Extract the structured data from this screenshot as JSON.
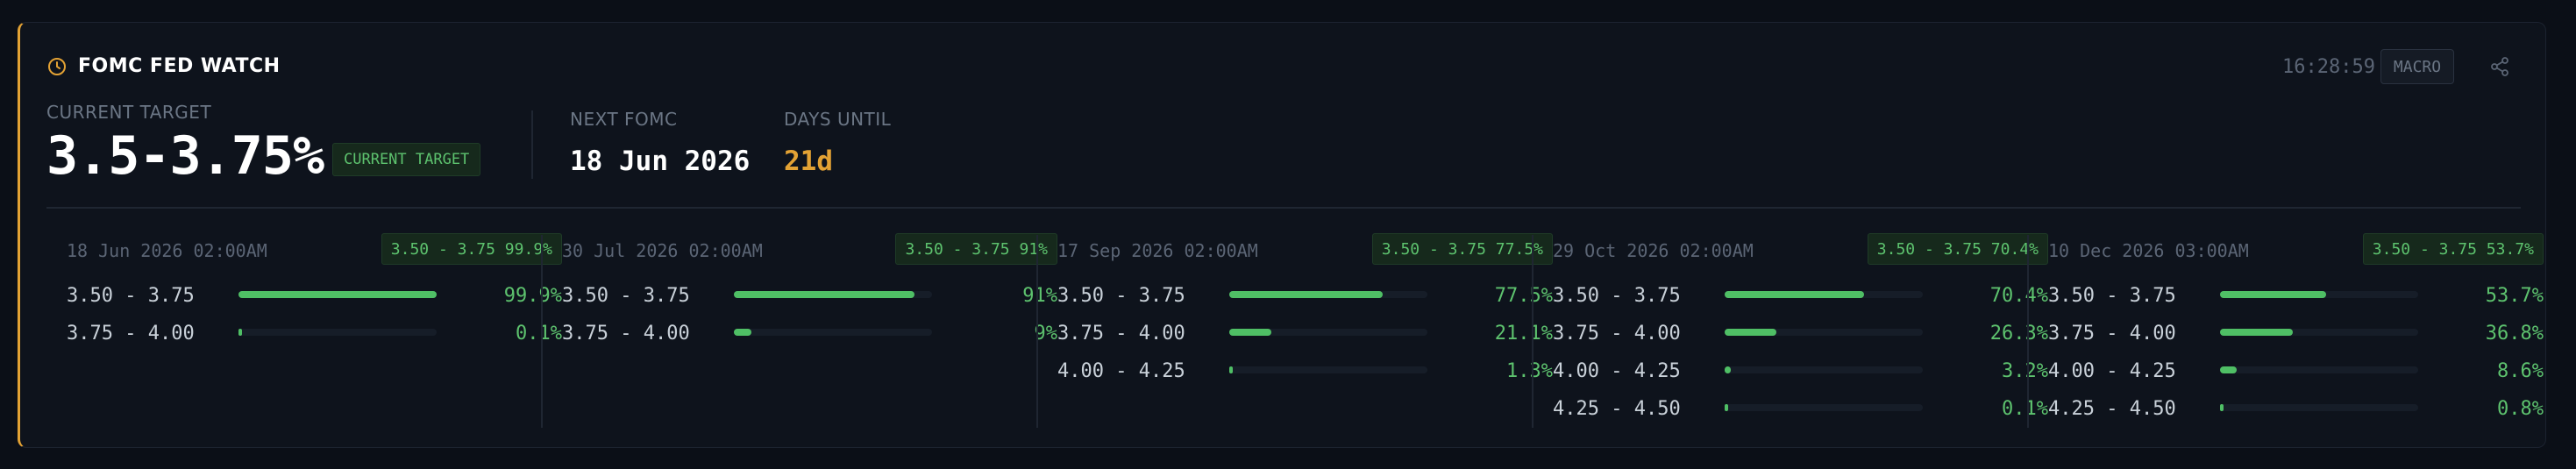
{
  "header": {
    "title": "FOMC FED WATCH",
    "time": "16:28:59",
    "badge": "MACRO",
    "icons": {
      "title": "clock-icon",
      "action": "share-icon"
    }
  },
  "summary": {
    "current_target_label": "CURRENT TARGET",
    "current_target_value": "3.5-3.75%",
    "current_target_badge": "CURRENT TARGET",
    "next_fomc_label": "NEXT FOMC",
    "next_fomc_value": "18 Jun 2026",
    "days_until_label": "DAYS UNTIL",
    "days_until_value": "21d"
  },
  "colors": {
    "accent": "#e3a234",
    "positive": "#5dc26e",
    "bar": "#4fbf65",
    "background": "#0e131c"
  },
  "meetings": [
    {
      "date": "18 Jun 2026 02:00AM",
      "badge": "3.50 - 3.75 99.9%",
      "rows": [
        {
          "range": "3.50 - 3.75",
          "pct": "99.9%",
          "prob": 0.999
        },
        {
          "range": "3.75 - 4.00",
          "pct": "0.1%",
          "prob": 0.001
        }
      ]
    },
    {
      "date": "30 Jul 2026 02:00AM",
      "badge": "3.50 - 3.75 91%",
      "rows": [
        {
          "range": "3.50 - 3.75",
          "pct": "91%",
          "prob": 0.91
        },
        {
          "range": "3.75 - 4.00",
          "pct": "9%",
          "prob": 0.09
        }
      ]
    },
    {
      "date": "17 Sep 2026 02:00AM",
      "badge": "3.50 - 3.75 77.5%",
      "rows": [
        {
          "range": "3.50 - 3.75",
          "pct": "77.5%",
          "prob": 0.775
        },
        {
          "range": "3.75 - 4.00",
          "pct": "21.1%",
          "prob": 0.211
        },
        {
          "range": "4.00 - 4.25",
          "pct": "1.3%",
          "prob": 0.013
        }
      ]
    },
    {
      "date": "29 Oct 2026 02:00AM",
      "badge": "3.50 - 3.75 70.4%",
      "rows": [
        {
          "range": "3.50 - 3.75",
          "pct": "70.4%",
          "prob": 0.704
        },
        {
          "range": "3.75 - 4.00",
          "pct": "26.3%",
          "prob": 0.263
        },
        {
          "range": "4.00 - 4.25",
          "pct": "3.2%",
          "prob": 0.032
        },
        {
          "range": "4.25 - 4.50",
          "pct": "0.1%",
          "prob": 0.001
        }
      ]
    },
    {
      "date": "10 Dec 2026 03:00AM",
      "badge": "3.50 - 3.75 53.7%",
      "rows": [
        {
          "range": "3.50 - 3.75",
          "pct": "53.7%",
          "prob": 0.537
        },
        {
          "range": "3.75 - 4.00",
          "pct": "36.8%",
          "prob": 0.368
        },
        {
          "range": "4.00 - 4.25",
          "pct": "8.6%",
          "prob": 0.086
        },
        {
          "range": "4.25 - 4.50",
          "pct": "0.8%",
          "prob": 0.008
        }
      ]
    }
  ]
}
